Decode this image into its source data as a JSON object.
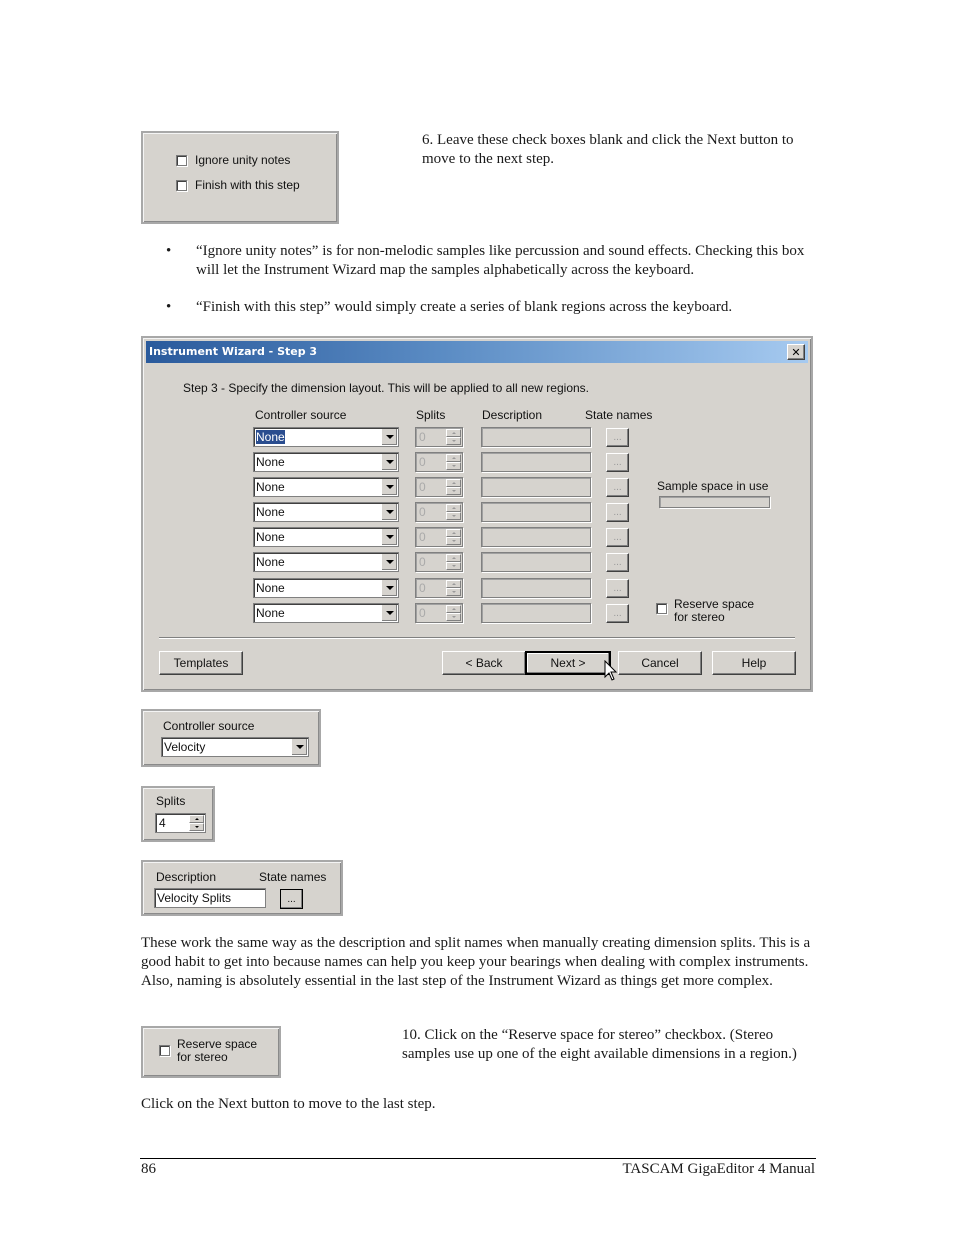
{
  "step6": {
    "checkboxes": [
      {
        "label": "Ignore unity notes",
        "checked": false
      },
      {
        "label": "Finish with this step",
        "checked": false
      }
    ],
    "text": "6. Leave these check boxes blank and click the Next button to move to the next step."
  },
  "bullets": [
    "“Ignore unity notes” is for non-melodic samples like percussion and sound effects.  Checking this box will let the Instrument Wizard map the samples alphabetically across the keyboard.",
    "“Finish with this step” would simply create a series of blank regions across the keyboard."
  ],
  "bullet_glyph": "•",
  "wizard": {
    "title": "Instrument Wizard - Step 3",
    "close_glyph": "✕",
    "instruction": "Step 3 - Specify the dimension layout.  This will be applied to all new regions.",
    "columns": {
      "controller_source": "Controller source",
      "splits": "Splits",
      "description": "Description",
      "state_names": "State names"
    },
    "rows": [
      {
        "controller": "None",
        "splits": "0",
        "description": "",
        "state_btn": "...",
        "selected": true
      },
      {
        "controller": "None",
        "splits": "0",
        "description": "",
        "state_btn": "..."
      },
      {
        "controller": "None",
        "splits": "0",
        "description": "",
        "state_btn": "..."
      },
      {
        "controller": "None",
        "splits": "0",
        "description": "",
        "state_btn": "..."
      },
      {
        "controller": "None",
        "splits": "0",
        "description": "",
        "state_btn": "..."
      },
      {
        "controller": "None",
        "splits": "0",
        "description": "",
        "state_btn": "..."
      },
      {
        "controller": "None",
        "splits": "0",
        "description": "",
        "state_btn": "..."
      },
      {
        "controller": "None",
        "splits": "0",
        "description": "",
        "state_btn": "..."
      }
    ],
    "sample_space_label": "Sample space in use",
    "sample_space_value": 0,
    "reserve_stereo": {
      "label_line1": "Reserve space",
      "label_line2": "for stereo",
      "checked": false
    },
    "buttons": {
      "templates": "Templates",
      "back": "< Back",
      "next": "Next >",
      "cancel": "Cancel",
      "help": "Help"
    }
  },
  "controller_example": {
    "label": "Controller source",
    "value": "Velocity"
  },
  "splits_example": {
    "label": "Splits",
    "value": "4"
  },
  "description_example": {
    "desc_label": "Description",
    "state_label": "State names",
    "desc_value": "Velocity Splits",
    "state_btn": "..."
  },
  "paragraph_names": "These work the same way as the description and split names when manually creating dimension splits.  This is a good habit to get into because names can help you keep your bearings when dealing with complex instruments.  Also, naming is absolutely essential in the last step of the Instrument Wizard as things get more complex.",
  "stereo_example": {
    "label_line1": "Reserve space",
    "label_line2": "for stereo",
    "checked": false
  },
  "step10_text": "10. Click on the “Reserve space for stereo” checkbox.  (Stereo samples use up one of the eight available dimensions in a region.)",
  "closing_text": "Click on the Next button to move to the last step.",
  "footer": {
    "page_number": "86",
    "title": "TASCAM GigaEditor 4 Manual"
  }
}
